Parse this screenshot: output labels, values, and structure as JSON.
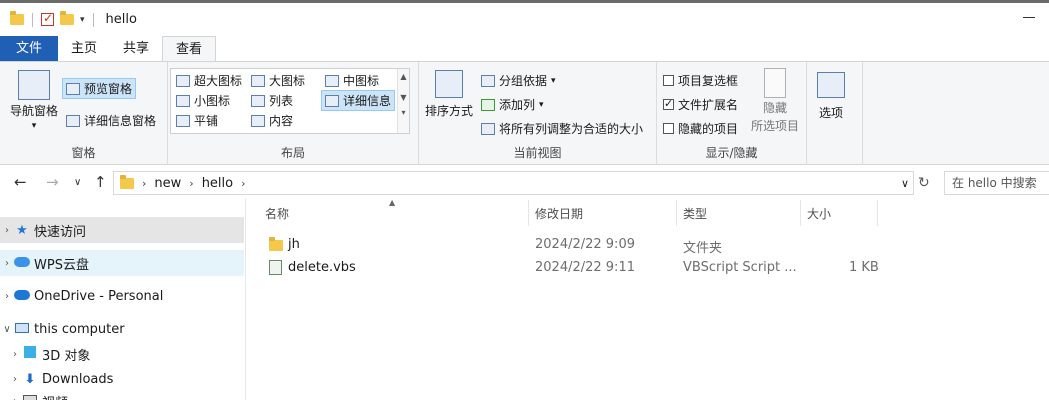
{
  "window": {
    "title": "hello"
  },
  "tabs": [
    {
      "label": "文件"
    },
    {
      "label": "主页"
    },
    {
      "label": "共享"
    },
    {
      "label": "查看"
    }
  ],
  "ribbon": {
    "panes_group": {
      "label": "窗格",
      "nav_pane": "导航窗格",
      "preview_pane": "预览窗格",
      "details_pane": "详细信息窗格"
    },
    "layout_group": {
      "label": "布局",
      "items": [
        "超大图标",
        "大图标",
        "中图标",
        "小图标",
        "列表",
        "详细信息",
        "平铺",
        "内容"
      ]
    },
    "current_view_group": {
      "label": "当前视图",
      "sort_by": "排序方式",
      "group_by": "分组依据",
      "add_column": "添加列",
      "fit_columns": "将所有列调整为合适的大小"
    },
    "show_hide_group": {
      "label": "显示/隐藏",
      "item_checkboxes": "项目复选框",
      "file_extensions": "文件扩展名",
      "hidden_items": "隐藏的项目",
      "hide_selected_1": "隐藏",
      "hide_selected_2": "所选项目",
      "item_checkboxes_checked": false,
      "file_extensions_checked": true,
      "hidden_items_checked": false
    },
    "options": {
      "label": "选项"
    }
  },
  "address": {
    "path": [
      "new",
      "hello"
    ],
    "search_placeholder": "在 hello 中搜索"
  },
  "nav_pane": {
    "items": [
      {
        "label": "快速访问"
      },
      {
        "label": "WPS云盘"
      },
      {
        "label": "OneDrive - Personal"
      },
      {
        "label": "this computer"
      },
      {
        "label": "3D 对象"
      },
      {
        "label": "Downloads"
      },
      {
        "label": "视频"
      }
    ]
  },
  "file_list": {
    "columns": [
      "名称",
      "修改日期",
      "类型",
      "大小"
    ],
    "rows": [
      {
        "name": "jh",
        "modified": "2024/2/22 9:09",
        "type": "文件夹",
        "size": ""
      },
      {
        "name": "delete.vbs",
        "modified": "2024/2/22 9:11",
        "type": "VBScript Script ...",
        "size": "1 KB"
      }
    ]
  }
}
